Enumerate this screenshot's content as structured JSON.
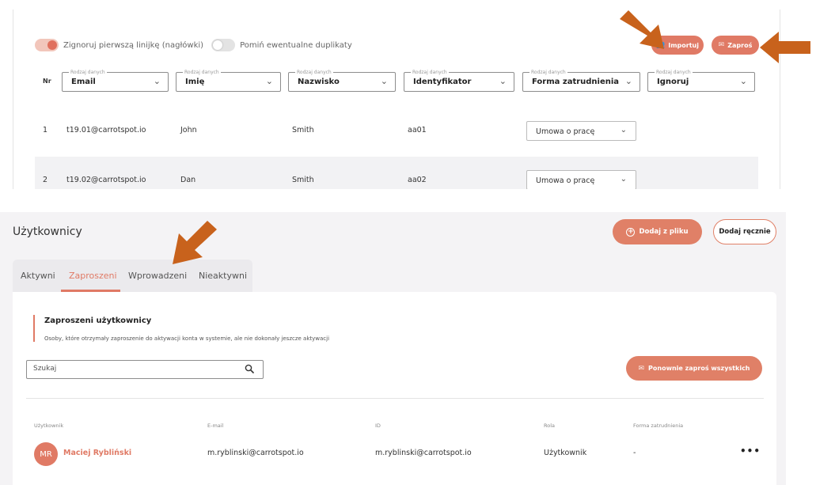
{
  "import_panel": {
    "toggles": [
      {
        "label": "Zignoruj pierwszą linijkę (nagłówki)",
        "on": true
      },
      {
        "label": "Pomiń ewentualne duplikaty",
        "on": false
      }
    ],
    "import_button": "Importuj",
    "invite_button": "Zaproś",
    "nr_header": "Nr",
    "field_legend": "Rodzaj danych",
    "columns": [
      "Email",
      "Imię",
      "Nazwisko",
      "Identyfikator",
      "Forma zatrudnienia",
      "Ignoruj"
    ],
    "rows": [
      {
        "nr": "1",
        "email": "t19.01@carrotspot.io",
        "first_name": "John",
        "last_name": "Smith",
        "id": "aa01",
        "employment": "Umowa o pracę"
      },
      {
        "nr": "2",
        "email": "t19.02@carrotspot.io",
        "first_name": "Dan",
        "last_name": "Smith",
        "id": "aa02",
        "employment": "Umowa o pracę"
      }
    ]
  },
  "users_page": {
    "title": "Użytkownicy",
    "add_from_file": "Dodaj z pliku",
    "add_manually": "Dodaj ręcznie",
    "tabs": [
      "Aktywni",
      "Zaproszeni",
      "Wprowadzeni",
      "Nieaktywni"
    ],
    "active_tab": "Zaproszeni",
    "section_title": "Zaproszeni użytkownicy",
    "section_description": "Osoby, które otrzymały zaproszenie do aktywacji konta w systemie, ale nie dokonały jeszcze aktywacji",
    "search_placeholder": "Szukaj",
    "reinvite_all": "Ponownie zaproś wszystkich",
    "table_headers": [
      "Użytkownik",
      "E-mail",
      "ID",
      "Rola",
      "Forma zatrudnienia"
    ],
    "user": {
      "initials": "MR",
      "name": "Maciej Rybliński",
      "email": "m.ryblinski@carrotspot.io",
      "id": "m.ryblinski@carrotspot.io",
      "role": "Użytkownik",
      "employment": "-"
    }
  },
  "colors": {
    "accent": "#e07a65",
    "arrow": "#c8621c"
  },
  "icons": [
    "users-icon",
    "mail-icon",
    "chevron-down-icon",
    "plus-circle-icon",
    "search-icon",
    "more-icon",
    "arrow-icon"
  ]
}
